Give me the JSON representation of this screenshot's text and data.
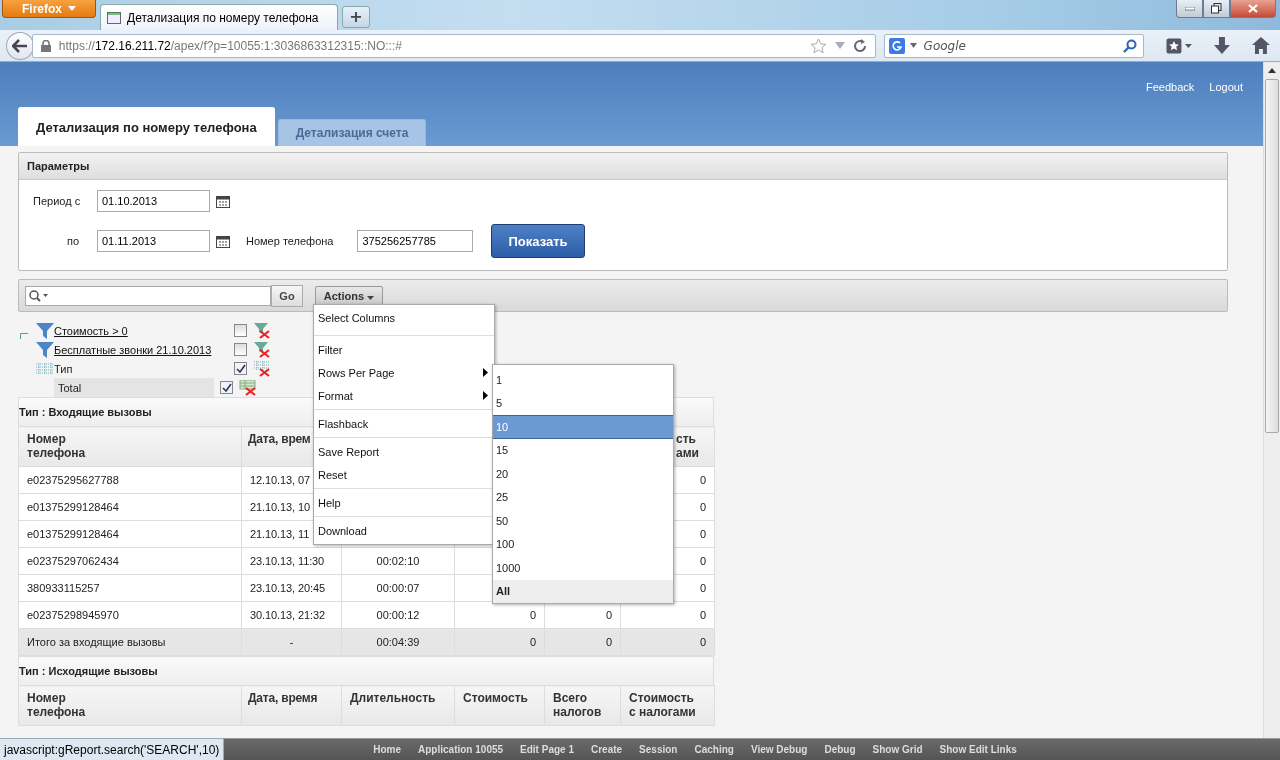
{
  "browser": {
    "firefox_button": "Firefox",
    "tab_title": "Детализация по номеру телефона",
    "new_tab": "+",
    "url_scheme": "https://",
    "url_host": "172.16.211.72",
    "url_path": "/apex/f?p=10055:1:3036863312315::NO:::#",
    "search_placeholder": "Google"
  },
  "header": {
    "links": [
      "Feedback",
      "Logout"
    ]
  },
  "tabs": [
    {
      "label": "Детализация по номеру телефона",
      "selected": true
    },
    {
      "label": "Детализация счета",
      "selected": false
    }
  ],
  "parameters": {
    "title": "Параметры",
    "from_label": "Период с",
    "from_value": "01.10.2013",
    "to_label": "по",
    "to_value": "01.11.2013",
    "phone_label": "Номер телефона",
    "phone_value": "375256257785",
    "show_button": "Показать"
  },
  "toolbar": {
    "go": "Go",
    "actions": "Actions"
  },
  "filters": [
    {
      "kind": "filter",
      "label": "Стоимость > 0",
      "checked": false
    },
    {
      "kind": "filter",
      "label": "Бесплатные звонки 21.10.2013",
      "checked": false
    },
    {
      "kind": "group",
      "label": "Тип",
      "checked": true
    },
    {
      "kind": "total",
      "label": "Total",
      "checked": true
    }
  ],
  "actions_menu": [
    {
      "items": [
        {
          "label": "Select Columns",
          "has_submenu": false
        }
      ]
    },
    {
      "items": [
        {
          "label": "Filter",
          "has_submenu": false
        },
        {
          "label": "Rows Per Page",
          "has_submenu": true
        },
        {
          "label": "Format",
          "has_submenu": true
        }
      ]
    },
    {
      "items": [
        {
          "label": "Flashback",
          "has_submenu": false
        }
      ]
    },
    {
      "items": [
        {
          "label": "Save Report",
          "has_submenu": false
        },
        {
          "label": "Reset",
          "has_submenu": false
        }
      ]
    },
    {
      "items": [
        {
          "label": "Help",
          "has_submenu": false
        }
      ]
    },
    {
      "items": [
        {
          "label": "Download",
          "has_submenu": false
        }
      ]
    }
  ],
  "rows_per_page": [
    {
      "kind": "option",
      "label": "1",
      "selected": false
    },
    {
      "kind": "option",
      "label": "5",
      "selected": false
    },
    {
      "kind": "option",
      "label": "10",
      "selected": true
    },
    {
      "kind": "option",
      "label": "15",
      "selected": false
    },
    {
      "kind": "option",
      "label": "20",
      "selected": false
    },
    {
      "kind": "option",
      "label": "25",
      "selected": false
    },
    {
      "kind": "option",
      "label": "50",
      "selected": false
    },
    {
      "kind": "option",
      "label": "100",
      "selected": false
    },
    {
      "kind": "option",
      "label": "1000",
      "selected": false
    },
    {
      "kind": "all",
      "label": "All",
      "selected": false
    }
  ],
  "reports": [
    {
      "title": "Тип : Входящие вызовы",
      "columns": {
        "phone": "Номер\nтелефона",
        "datetime": "Дата, врем",
        "total": "сть\nами"
      },
      "rows": [
        {
          "phone": "e02375295627788",
          "datetime": "12.10.13, 07",
          "total": "0"
        },
        {
          "phone": "e01375299128464",
          "datetime": "21.10.13, 10",
          "total": "0"
        },
        {
          "phone": "e01375299128464",
          "datetime": "21.10.13, 11",
          "total": "0"
        },
        {
          "phone": "e02375297062434",
          "datetime": "23.10.13, 11:30",
          "duration": "00:02:10",
          "total": "0"
        },
        {
          "phone": "380933115257",
          "datetime": "23.10.13, 20:45",
          "duration": "00:00:07",
          "total": "0"
        },
        {
          "phone": "e02375298945970",
          "datetime": "30.10.13, 21:32",
          "duration": "00:00:12",
          "cost": "0",
          "tax": "0",
          "total": "0"
        }
      ],
      "summary": {
        "phone": "Итого за входящие вызовы",
        "datetime": "-",
        "duration": "00:04:39",
        "cost": "0",
        "tax": "0",
        "total": "0"
      }
    },
    {
      "title": "Тип : Исходящие вызовы",
      "columns": {
        "phone": "Номер\nтелефона",
        "datetime": "Дата, время",
        "duration": "Длительность",
        "cost": "Стоимость",
        "tax": "Всего\nналогов",
        "total": "Стоимость\nс налогами"
      }
    }
  ],
  "dev_toolbar": [
    "Home",
    "Application 10055",
    "Edit Page 1",
    "Create",
    "Session",
    "Caching",
    "View Debug",
    "Debug",
    "Show Grid",
    "Show Edit Links"
  ],
  "status_text": "javascript:gReport.search('SEARCH',10)"
}
